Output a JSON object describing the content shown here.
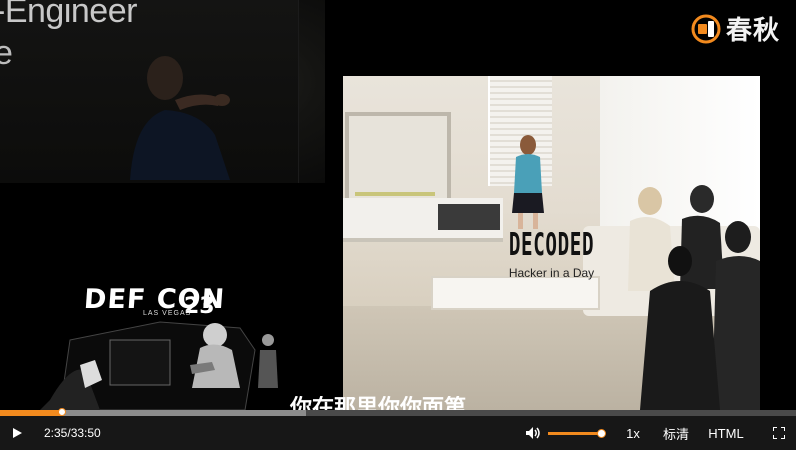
{
  "video": {
    "speaker_slide_line1": "-Engineer",
    "speaker_slide_line2": "e",
    "slide_title": "DECODED",
    "slide_subtitle": "Hacker in a Day",
    "event_logo_name": "DEF CON",
    "event_logo_number": "23",
    "event_logo_location": "LAS VEGAS",
    "subtitle_text": "你在那里你你面第"
  },
  "watermark": {
    "brand_text": "春秋",
    "icon": "chunqiu-logo-icon",
    "accent_color": "#f28a1e"
  },
  "progress": {
    "played_fraction": 0.078,
    "buffered_fraction": 0.384,
    "played_color": "#f28a1e",
    "buffered_color": "#8c8c8c"
  },
  "controls": {
    "play_icon": "play-icon",
    "time_display": "2:35/33:50",
    "volume_icon": "volume-icon",
    "volume_level": 0.95,
    "speed_label": "1x",
    "quality_label": "标清",
    "format_label": "HTML",
    "fullscreen_icon": "fullscreen-icon"
  }
}
